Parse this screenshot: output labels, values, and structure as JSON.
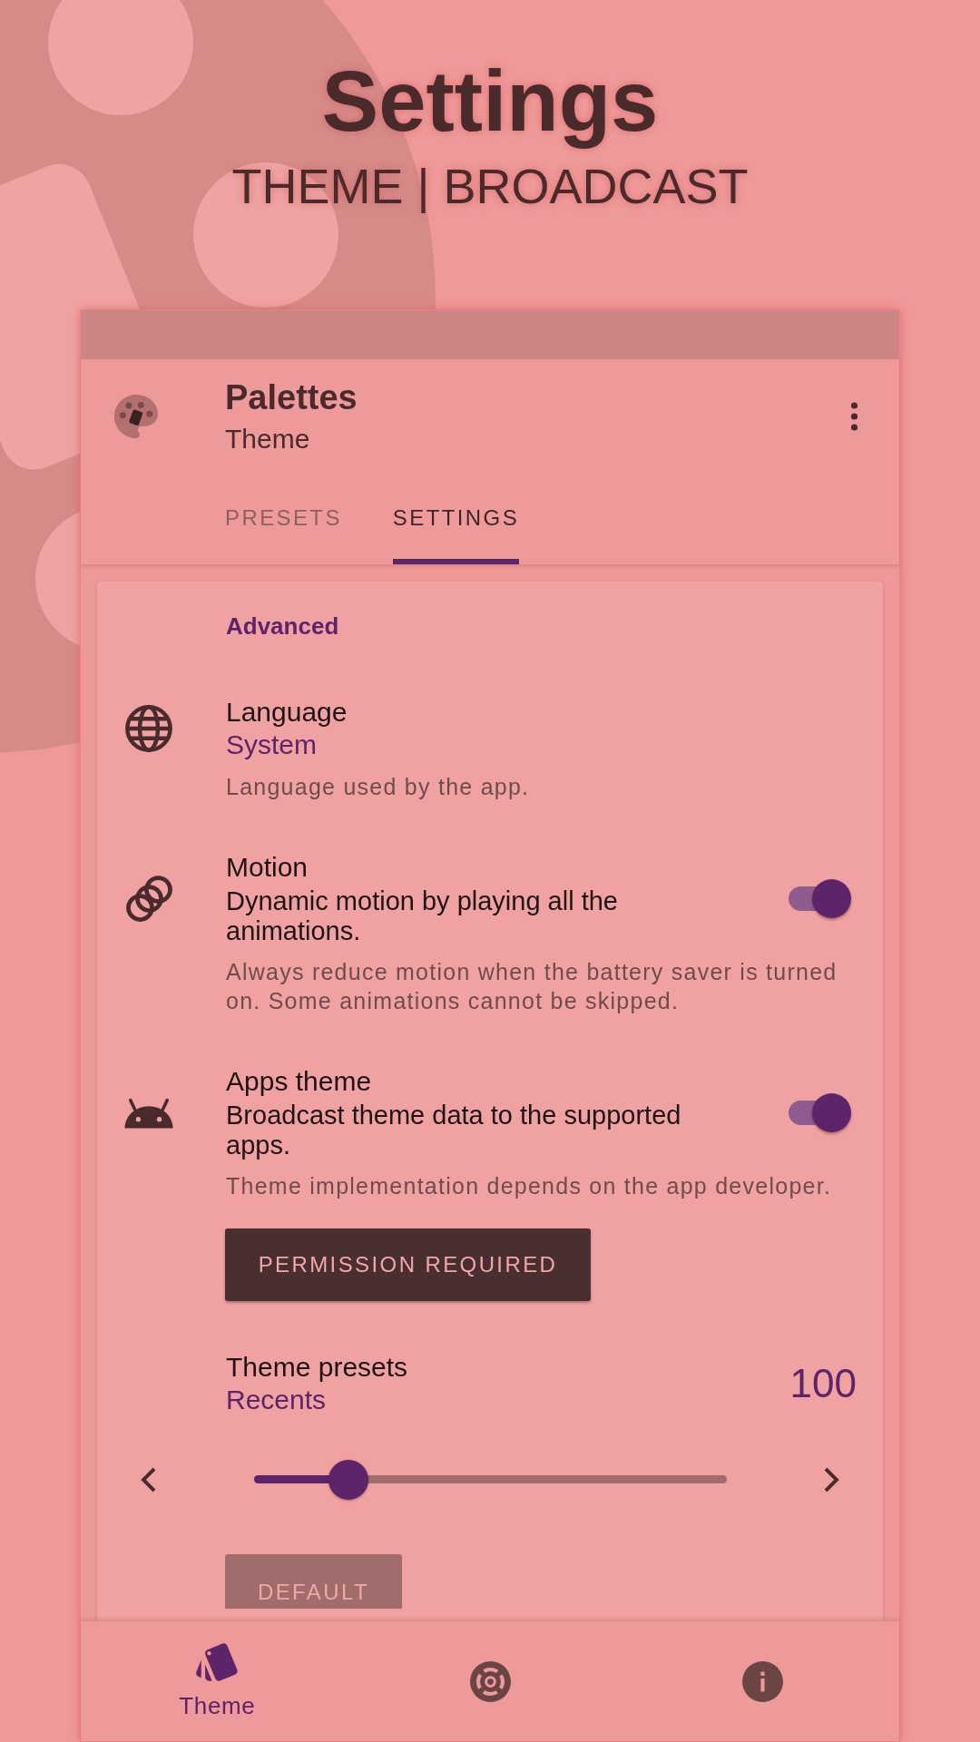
{
  "header": {
    "title": "Settings",
    "subtitle": "THEME | BROADCAST"
  },
  "app_bar": {
    "title": "Palettes",
    "subtitle": "Theme"
  },
  "tabs": [
    {
      "label": "PRESETS",
      "selected": false
    },
    {
      "label": "SETTINGS",
      "selected": true
    }
  ],
  "section": {
    "title": "Advanced",
    "preferences": [
      {
        "kind": "value",
        "title": "Language",
        "value": "System",
        "description": "Language used by the app."
      },
      {
        "kind": "switch",
        "title": "Motion",
        "summary": "Dynamic motion by playing all the animations.",
        "on": true,
        "description": "Always reduce motion when the battery saver is turned on. Some animations cannot be skipped."
      },
      {
        "kind": "switch",
        "title": "Apps theme",
        "summary": "Broadcast theme data to the supported apps.",
        "on": true,
        "description": "Theme implementation depends on the app developer.",
        "button": {
          "label": "PERMISSION REQUIRED",
          "disabled": false
        }
      },
      {
        "kind": "slider",
        "title": "Theme presets",
        "value": "Recents",
        "reading": "100",
        "level": 0.2,
        "button": {
          "label": "DEFAULT",
          "disabled": true
        }
      }
    ]
  },
  "bottom_nav": [
    {
      "label": "Theme",
      "selected": true
    },
    {
      "selected": false
    },
    {
      "selected": false
    }
  ]
}
